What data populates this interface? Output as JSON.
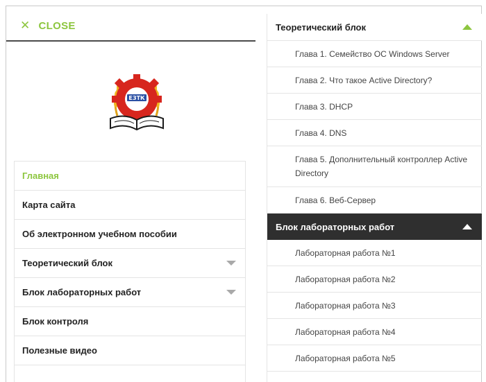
{
  "close": {
    "icon": "close-x-icon",
    "glyph": "✕",
    "label": "CLOSE"
  },
  "logo": {
    "icon": "university-emblem-icon",
    "emblem_text": "ЕЗТК"
  },
  "colors": {
    "accent": "#8dc63f",
    "dark": "#2f2f2f",
    "border": "#e4e4e4",
    "emblem_red": "#d7261e"
  },
  "menu": {
    "items": [
      {
        "label": "Главная",
        "active": true,
        "has_children": false
      },
      {
        "label": "Карта сайта",
        "active": false,
        "has_children": false
      },
      {
        "label": "Об электронном учебном пособии",
        "active": false,
        "has_children": false
      },
      {
        "label": "Теоретический блок",
        "active": false,
        "has_children": true
      },
      {
        "label": "Блок лабораторных работ",
        "active": false,
        "has_children": true
      },
      {
        "label": "Блок контроля",
        "active": false,
        "has_children": false
      },
      {
        "label": "Полезные видео",
        "active": false,
        "has_children": false
      }
    ]
  },
  "submenu": {
    "theory": {
      "title": "Теоретический блок",
      "expanded": true,
      "items": [
        "Глава 1. Семейство ОС Windows Server",
        "Глава 2. Что такое Active Directory?",
        "Глава 3. DHCP",
        "Глава 4. DNS",
        "Глава 5. Дополнительный контроллер Active Directory",
        "Глава 6. Веб-Сервер"
      ]
    },
    "labs": {
      "title": "Блок лабораторных работ",
      "expanded": true,
      "items": [
        "Лабораторная работа №1",
        "Лабораторная работа №2",
        "Лабораторная работа №3",
        "Лабораторная работа №4",
        "Лабораторная работа №5"
      ]
    }
  }
}
